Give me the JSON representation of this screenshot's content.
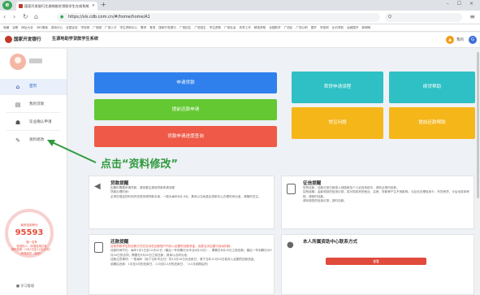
{
  "browser": {
    "logo_letter": "e",
    "tab_title": "国家开发银行生源地助学贷款学生在线系统",
    "url": "https://sls.cdb.com.cn/#/home/home/A1",
    "search_placeholder": "Q",
    "bookmarks": [
      "收藏",
      "谷歌",
      "网址大全",
      "360搜索",
      "游戏中心",
      "全国征信",
      "学信网",
      "广西团",
      "广西人才",
      "学生资助中心",
      "需求",
      "登录",
      "国家开发银行",
      "广西招生",
      "广西招生",
      "学生资助",
      "广西社会",
      "扶贫工作",
      "精准资助",
      "全国助学",
      "广西区",
      "广西公积",
      "国开",
      "学信网",
      "比价导航",
      "运维国开",
      "新闻网"
    ]
  },
  "header": {
    "bank_name": "国家开发银行",
    "system_name": "生源地助学贷款学生系统",
    "user_name": "我的",
    "user_avatar_glyph": "▲",
    "logout_glyph": "G"
  },
  "sidebar": {
    "items": [
      {
        "label": "首页",
        "icon": "home-icon",
        "glyph": "⌂"
      },
      {
        "label": "我的贷款",
        "icon": "document-icon",
        "glyph": "▤"
      },
      {
        "label": "毕业确认申请",
        "icon": "graduation-icon",
        "glyph": "☗"
      },
      {
        "label": "资料修改",
        "icon": "edit-icon",
        "glyph": "✎"
      }
    ],
    "credit_label": "我的信用积分",
    "credit_score": "95593",
    "credit_info": [
      "做一名有",
      "信用的人，珍惜信用记录",
      "按时还款（1月1日至12月20日）",
      "申请续贷（每年）"
    ],
    "bottom_label": "■ 学习管理"
  },
  "buttons": {
    "apply": "申请贷款",
    "confirm": "提前还款申请",
    "progress": "贷款申请进度查询",
    "flow": "首贷申请流程",
    "help": "续贷帮助",
    "faq": "常见问题",
    "cert": "提前还款帮助"
  },
  "annotation": {
    "text": "点击“资料修改”",
    "color": "#2f9a3e"
  },
  "cards": {
    "loan": {
      "title": "贷款提醒",
      "lines": [
        "如果你需要申请贷款，请查看生源地贷款申请流程",
        "贷款办理时间：",
        "必须在规定的时间内完成申请贷款手续，一般为每年6月-9月，具体以当地县区资助中心办理时间为准，请随时关注。"
      ]
    },
    "credit": {
      "title": "征信提醒",
      "lines": [
        "您的还款、还款记录已被录入到国家及个人征信系统中，请务必按时还款。",
        "如有逾期，会影响您的信用记录，将对您将来的就业、买房、贷款等产生不良影响，今后也办理信用卡、车贷房贷，今后也将到审核，请按时还款。",
        "请珍惜您的信用记录，按时还款。"
      ]
    },
    "repay": {
      "title": "还款提醒",
      "warn": "目前贷款学生的还款方式仅支持在还款账户内存入足额的还款资金，还款当天由银行自动扣款。",
      "lines": [
        "还款时间节日：每年1月1日至12月20日（最后一年到期日为毕业6月20日），需要在6月20日之前还款；最后一年到期日为9月20日的合同，需要在9月20日之前还款，具体以合同为准。",
        "还款注意事项：一般每年（除了当年毕业日）的12月20日为还款日，请于当年12月20日前存入足额的还款资金。",
        "逾期后还款：1月至3月的还款日，11月至12月的还款日，（11月逾期后的）"
      ]
    },
    "contact": {
      "title": "本人所属资助中心联系方式",
      "button": "查看"
    }
  }
}
